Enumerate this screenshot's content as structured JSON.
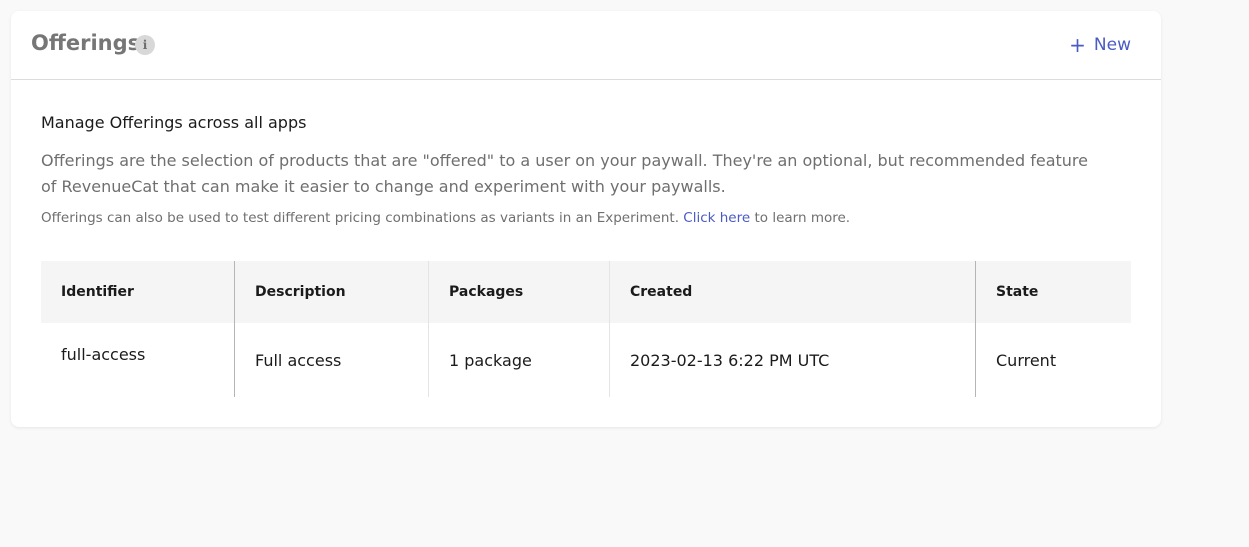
{
  "header": {
    "title": "Offerings",
    "info_icon": "i",
    "new_button_icon": "+",
    "new_button_label": "New"
  },
  "intro": {
    "heading": "Manage Offerings across all apps",
    "description": "Offerings are the selection of products that are \"offered\" to a user on your paywall. They're an optional, but recommended feature of RevenueCat that can make it easier to change and experiment with your paywalls.",
    "note_prefix": "Offerings can also be used to test different pricing combinations as variants in an Experiment.",
    "note_link": "Click here",
    "note_suffix": "to learn more."
  },
  "table": {
    "columns": [
      "Identifier",
      "Description",
      "Packages",
      "Created",
      "State"
    ],
    "rows": [
      [
        "full-access",
        "Full access",
        "1 package",
        "2023-02-13 6:22 PM UTC",
        "Current"
      ]
    ]
  },
  "colors": {
    "accent": "#4a5bc4",
    "background": "#f9f9f9",
    "card": "#ffffff",
    "header_row": "#f5f5f5"
  }
}
